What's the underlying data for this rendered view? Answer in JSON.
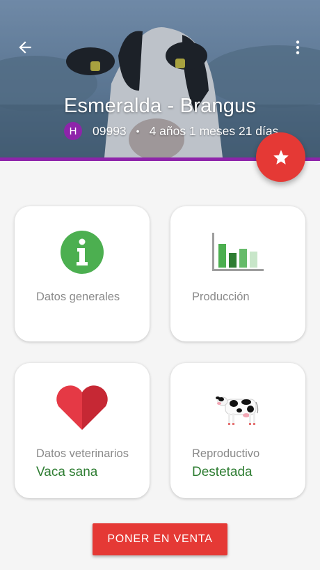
{
  "header": {
    "title": "Esmeralda - Brangus",
    "sex_badge": "H",
    "id_number": "09993",
    "separator": "•",
    "age": "4 años 1 meses 21 días",
    "accent_color": "#8e24aa"
  },
  "icons": {
    "back": "arrow-left-icon",
    "more": "more-vertical-icon",
    "favorite": "star-icon"
  },
  "cards": {
    "general": {
      "label": "Datos generales",
      "icon": "info-icon"
    },
    "production": {
      "label": "Producción",
      "icon": "bar-chart-icon"
    },
    "veterinary": {
      "label": "Datos veterinarios",
      "status": "Vaca sana",
      "icon": "heart-icon"
    },
    "reproductive": {
      "label": "Reproductivo",
      "status": "Destetada",
      "icon": "cow-icon"
    }
  },
  "actions": {
    "sell_label": "PONER EN VENTA"
  },
  "colors": {
    "primary_red": "#e53935",
    "status_green": "#2e7d32",
    "info_green": "#4caf50"
  }
}
